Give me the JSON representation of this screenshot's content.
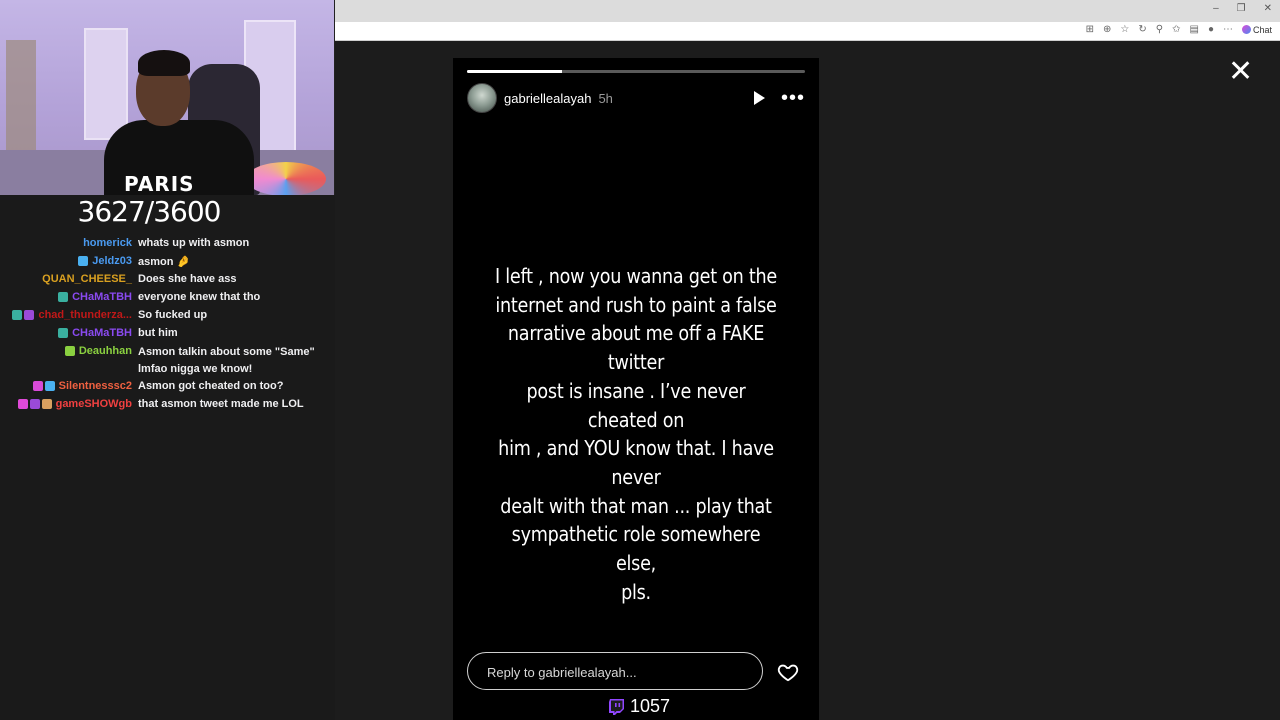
{
  "webcam": {
    "shirt_text": "PARIS"
  },
  "counter": {
    "text": "3627/3600"
  },
  "chat": [
    {
      "user": "homerick",
      "text": "whats up with asmon",
      "color": "#4a9af0",
      "badges": []
    },
    {
      "user": "Jeldz03",
      "text": "asmon 🤌",
      "color": "#4a9af0",
      "badges": [
        "#4ab0f0"
      ]
    },
    {
      "user": "QUAN_CHEESE_",
      "text": "Does she have ass",
      "color": "#d9a020",
      "badges": []
    },
    {
      "user": "CHaMaTBH",
      "text": "everyone knew that tho",
      "color": "#8a4af0",
      "badges": [
        "#3ab0a0"
      ]
    },
    {
      "user": "chad_thunderza...",
      "text": "So fucked up",
      "color": "#c01818",
      "badges": [
        "#3ab0a0",
        "#9a4ad8"
      ]
    },
    {
      "user": "CHaMaTBH",
      "text": "but him",
      "color": "#8a4af0",
      "badges": [
        "#3ab0a0"
      ]
    },
    {
      "user": "Deauhhan",
      "text": "Asmon talkin about some \"Same\" lmfao nigga we know!",
      "color": "#8ad040",
      "badges": [
        "#8ad040"
      ]
    },
    {
      "user": "Silentnesssc2",
      "text": "Asmon got cheated on too?",
      "color": "#f06040",
      "badges": [
        "#d84ad8",
        "#4ab0f0"
      ]
    },
    {
      "user": "gameSHOWgb",
      "text": "that asmon tweet made me LOL",
      "color": "#f04040",
      "badges": [
        "#e04ad8",
        "#9a4ad8",
        "#d8a060"
      ]
    }
  ],
  "browser": {
    "chat_button": "Chat",
    "window_controls": [
      "–",
      "❐",
      "✕"
    ]
  },
  "story": {
    "progress": 0.28,
    "username": "gabriellealayah",
    "time": "5h",
    "lines": [
      "I left ,  now you wanna get on the",
      "internet and rush to paint a false",
      "narrative about me off a FAKE twitter",
      "post is insane . I’ve never cheated on",
      "him , and YOU know that. I have never",
      "dealt with that man   ... play that",
      "sympathetic role somewhere else,",
      "pls."
    ],
    "reply_placeholder": "Reply to gabriellealayah..."
  },
  "viewers": {
    "count": "1057"
  },
  "colors": {
    "story_bg": "#000000",
    "viewer_bg": "#1c1c1c",
    "twitch_purple": "#9146ff"
  }
}
